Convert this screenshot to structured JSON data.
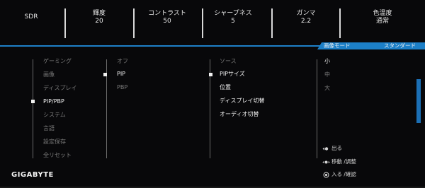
{
  "topbar": {
    "items": [
      {
        "label": "SDR",
        "value": ""
      },
      {
        "label": "輝度",
        "value": "20"
      },
      {
        "label": "コントラスト",
        "value": "50"
      },
      {
        "label": "シャープネス",
        "value": "5"
      },
      {
        "label": "ガンマ",
        "value": "2.2"
      },
      {
        "label": "色温度",
        "value": "通常"
      }
    ]
  },
  "mode_bar": {
    "label": "画像モード",
    "value": "スタンダード",
    "accent_color": "#1c7fc7"
  },
  "menu": {
    "main": [
      "ゲーミング",
      "画像",
      "ディスプレイ",
      "PIP/PBP",
      "システム",
      "言語",
      "設定保存",
      "全リセット"
    ],
    "main_selected": "PIP/PBP",
    "sub1": [
      "オフ",
      "PIP",
      "PBP"
    ],
    "sub1_selected": "PIP",
    "sub2": [
      "ソース",
      "PIPサイズ",
      "位置",
      "ディスプレイ切替",
      "オーディオ切替"
    ],
    "sub2_selected": "PIPサイズ",
    "sub3": [
      "小",
      "中",
      "大"
    ],
    "sub3_selected": "小"
  },
  "hints": [
    {
      "icon": "joystick-left-icon",
      "label": "出る"
    },
    {
      "icon": "joystick-move-icon",
      "label": "移動 /調整"
    },
    {
      "icon": "joystick-press-icon",
      "label": "入る /確認"
    }
  ],
  "brand": "GIGABYTE"
}
